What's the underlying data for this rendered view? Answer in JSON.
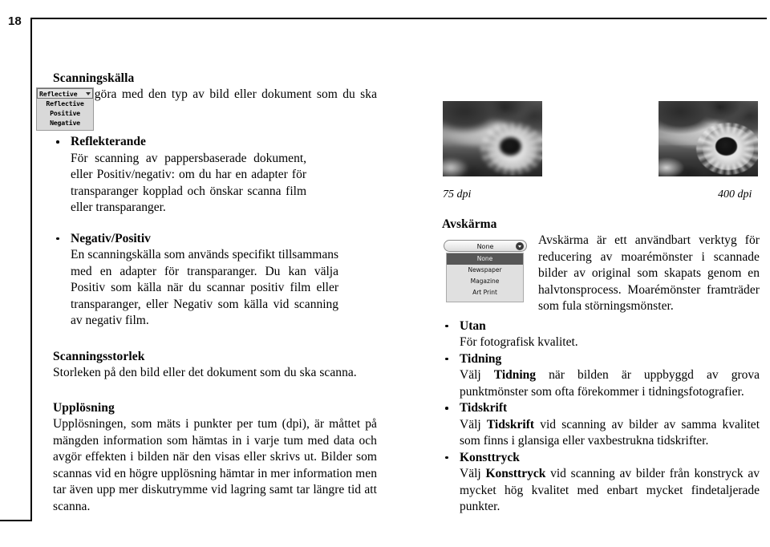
{
  "page": {
    "number": "18"
  },
  "left_column": {
    "heading_1": "Scanningskälla",
    "intro": "Har att göra med den typ av bild eller dokument som du ska scanna.",
    "bullets": [
      {
        "title": "Reflekterande",
        "body": "För scanning av pappersbaserade dokument, eller Positiv/negativ: om du har en adapter för transparanger kopplad och önskar scanna film eller transparanger."
      },
      {
        "title": "Negativ/Positiv",
        "body": "En scanningskälla som används specifikt tillsammans med en adapter för transparanger. Du kan välja Positiv som källa när du scannar positiv film eller transparanger, eller Negativ som källa vid scanning av negativ film."
      }
    ],
    "heading_2": "Scanningsstorlek",
    "body_2": "Storleken på den bild eller det dokument som du ska scanna.",
    "heading_3": "Upplösning",
    "body_3": "Upplösningen, som mäts i punkter per tum (dpi), är måttet på mängden information som hämtas in i varje tum med data och avgör effekten i bilden när den visas eller skrivs ut. Bilder som scannas vid en högre upplösning hämtar in mer information men tar även upp mer diskutrymme vid lagring samt tar längre tid att scanna."
  },
  "scan_source_dropdown": {
    "selected": "Reflective",
    "options": [
      "Reflective",
      "Positive",
      "Negative"
    ]
  },
  "samples": {
    "left_caption": "75 dpi",
    "right_caption": "400 dpi"
  },
  "right_column": {
    "heading_1": "Avskärma",
    "intro": "Avskärma är ett användbart verktyg för reducering av moarémönster i scannade bilder av original som skapats genom en halvtonsprocess.   Moarémönster framträder som fula störningsmönster.",
    "bullets": [
      {
        "title": "Utan",
        "body_pre": "För fotografisk kvalitet.",
        "body_bold": "",
        "body_post": ""
      },
      {
        "title": "Tidning",
        "body_pre": "Välj ",
        "body_bold": "Tidning",
        "body_post": " när bilden är uppbyggd av grova punktmönster som ofta förekommer i tidningsfotografier."
      },
      {
        "title": "Tidskrift",
        "body_pre": "Välj ",
        "body_bold": "Tidskrift",
        "body_post": " vid scanning av bilder av samma kvalitet som finns i glansiga eller vaxbestrukna tidskrifter."
      },
      {
        "title": "Konsttryck",
        "body_pre": "Välj ",
        "body_bold": "Konsttryck",
        "body_post": " vid scanning av bilder från konstryck av mycket hög kvalitet med enbart mycket findetaljerade punkter."
      }
    ]
  },
  "descreen_dropdown": {
    "selected": "None",
    "options": [
      "None",
      "Newspaper",
      "Magazine",
      "Art Print"
    ],
    "highlighted": "None"
  }
}
